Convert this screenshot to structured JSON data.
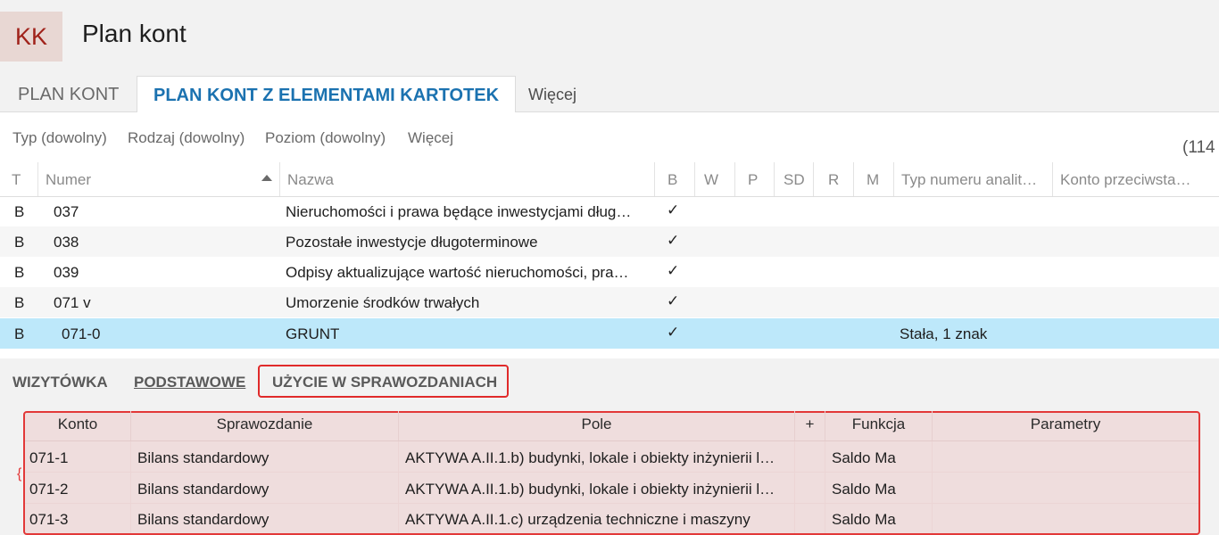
{
  "app": {
    "badge": "KK",
    "title": "Plan kont"
  },
  "tabs": {
    "plain": "PLAN KONT",
    "active": "PLAN KONT Z ELEMENTAMI KARTOTEK",
    "more": "Więcej"
  },
  "filters": {
    "typ": "Typ (dowolny)",
    "rodzaj": "Rodzaj (dowolny)",
    "poziom": "Poziom (dowolny)",
    "more": "Więcej",
    "count": "(114"
  },
  "grid": {
    "columns": [
      "T",
      "Numer",
      "Nazwa",
      "B",
      "W",
      "P",
      "SD",
      "R",
      "M",
      "Typ numeru analit…",
      "Konto przeciwsta…"
    ],
    "sort": {
      "column": "Numer",
      "direction": "ascending"
    },
    "rows": [
      {
        "t": "B",
        "numer": "037",
        "nazwa": "Nieruchomości i prawa będące inwestycjami dług…",
        "b": "✓",
        "typ": ""
      },
      {
        "t": "B",
        "numer": "038",
        "nazwa": "Pozostałe inwestycje długoterminowe",
        "b": "✓",
        "typ": ""
      },
      {
        "t": "B",
        "numer": "039",
        "nazwa": "Odpisy aktualizujące wartość nieruchomości, pra…",
        "b": "✓",
        "typ": ""
      },
      {
        "t": "B",
        "numer": "071 v",
        "nazwa": "Umorzenie środków trwałych",
        "b": "✓",
        "typ": ""
      },
      {
        "t": "B",
        "numer": "071-0",
        "nazwa": "GRUNT",
        "b": "✓",
        "typ": "Stała, 1 znak"
      }
    ]
  },
  "bottom_tabs": {
    "wizytowka": "WIZYTÓWKA",
    "podstawowe": "PODSTAWOWE",
    "uzycie": "UŻYCIE W SPRAWOZDANIACH"
  },
  "sub": {
    "columns": [
      "Konto",
      "Sprawozdanie",
      "Pole",
      "+",
      "Funkcja",
      "Parametry"
    ],
    "rows": [
      {
        "konto": "071-1",
        "sprawozdanie": "Bilans standardowy",
        "pole": "AKTYWA A.II.1.b) budynki, lokale i obiekty inżynierii l…",
        "plus": "",
        "funkcja": "Saldo Ma",
        "parametry": ""
      },
      {
        "konto": "071-2",
        "sprawozdanie": "Bilans standardowy",
        "pole": "AKTYWA A.II.1.b) budynki, lokale i obiekty inżynierii l…",
        "plus": "",
        "funkcja": "Saldo Ma",
        "parametry": ""
      },
      {
        "konto": "071-3",
        "sprawozdanie": "Bilans standardowy",
        "pole": "AKTYWA A.II.1.c) urządzenia techniczne i maszyny",
        "plus": "",
        "funkcja": "Saldo Ma",
        "parametry": ""
      }
    ]
  },
  "colors": {
    "accent": "#1b72b0",
    "selection": "#bde8fa",
    "highlight": "#e23838",
    "badge_text": "#a0221a"
  }
}
